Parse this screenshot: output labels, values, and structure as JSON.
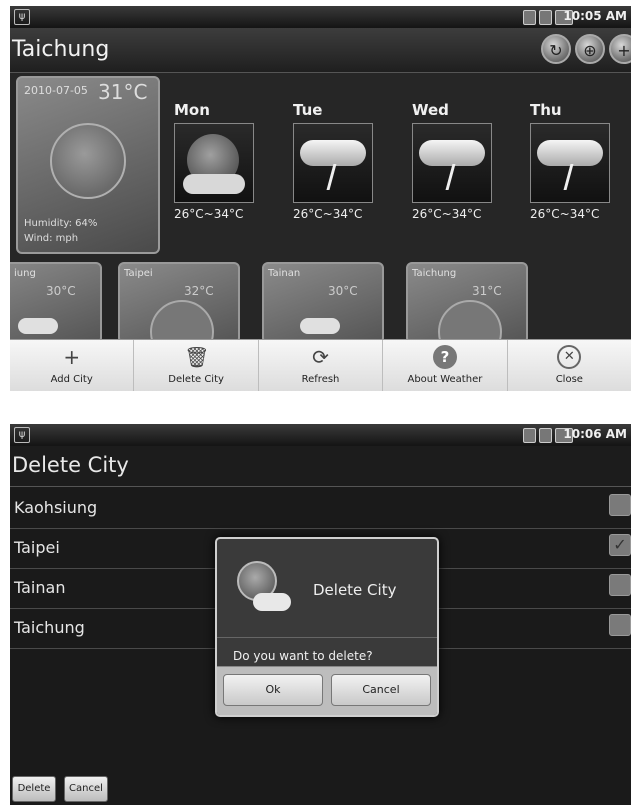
{
  "screen1": {
    "status_time": "10:05 AM",
    "title": "Taichung",
    "today": {
      "date": "2010-07-05",
      "temp": "31°C",
      "humidity": "Humidity: 64%",
      "wind": "Wind:  mph"
    },
    "forecast": [
      {
        "day": "Mon",
        "range": "26°C~34°C",
        "icon": "sun-cloud-icon"
      },
      {
        "day": "Tue",
        "range": "26°C~34°C",
        "icon": "thunderstorm-icon"
      },
      {
        "day": "Wed",
        "range": "26°C~34°C",
        "icon": "thunderstorm-icon"
      },
      {
        "day": "Thu",
        "range": "26°C~34°C",
        "icon": "thunderstorm-icon"
      }
    ],
    "cities": [
      {
        "name": "iung",
        "temp": "30°C"
      },
      {
        "name": "Taipei",
        "temp": "32°C"
      },
      {
        "name": "Tainan",
        "temp": "30°C"
      },
      {
        "name": "Taichung",
        "temp": "31°C"
      }
    ],
    "menu": [
      {
        "label": "Add City",
        "icon": "plus-icon"
      },
      {
        "label": "Delete City",
        "icon": "trash-icon"
      },
      {
        "label": "Refresh",
        "icon": "refresh-icon"
      },
      {
        "label": "About Weather",
        "icon": "help-icon"
      },
      {
        "label": "Close",
        "icon": "close-icon"
      }
    ]
  },
  "screen2": {
    "status_time": "10:06 AM",
    "title": "Delete City",
    "cities": [
      {
        "name": "Kaohsiung",
        "checked": false
      },
      {
        "name": "Taipei",
        "checked": true
      },
      {
        "name": "Tainan",
        "checked": false
      },
      {
        "name": "Taichung",
        "checked": false
      }
    ],
    "dialog": {
      "title": "Delete City",
      "message": "Do you want to delete?",
      "ok": "Ok",
      "cancel": "Cancel"
    },
    "buttons": {
      "delete": "Delete",
      "cancel": "Cancel"
    }
  }
}
